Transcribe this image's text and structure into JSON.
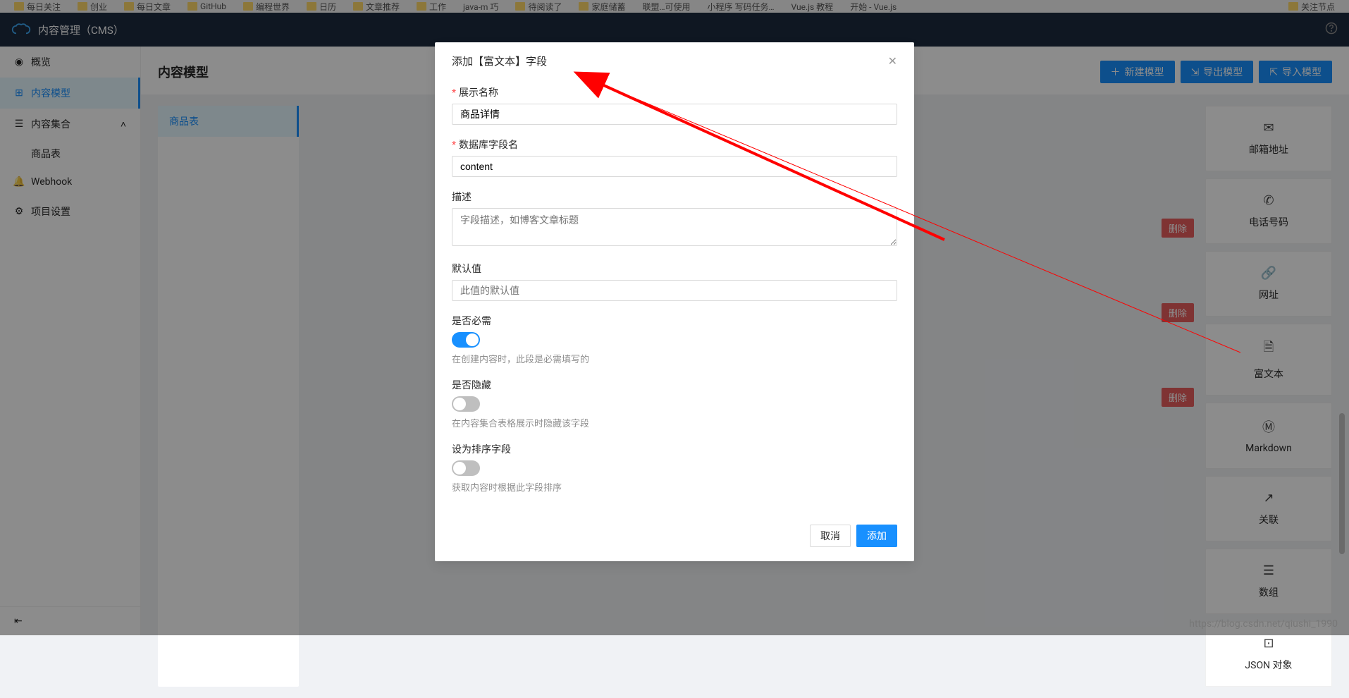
{
  "browserBar": {
    "bookmarks": [
      "每日关注",
      "创业",
      "每日文章",
      "GitHub",
      "编程世界",
      "日历",
      "文章推荐",
      "工作",
      "java-m 巧",
      "待阅读了",
      "家庭储蓄",
      "联盟…可使用",
      "小程序 写码任务…",
      "Vue.js 教程",
      "开始 - Vue.js"
    ],
    "bookmarkRight": "关注节点"
  },
  "appHeader": {
    "title": "内容管理（CMS）"
  },
  "sidebar": {
    "items": [
      "概览",
      "内容模型",
      "内容集合",
      "Webhook",
      "项目设置"
    ],
    "subItems": [
      "商品表"
    ]
  },
  "page": {
    "title": "内容模型",
    "actions": {
      "create": "新建模型",
      "export": "导出模型",
      "import": "导入模型"
    }
  },
  "leftPanel": {
    "item": "商品表"
  },
  "deleteLabel": "删除",
  "fieldTypes": {
    "email": "邮箱地址",
    "phone": "电话号码",
    "url": "网址",
    "richtext": "富文本",
    "markdown": "Markdown",
    "relation": "关联",
    "array": "数组",
    "json": "JSON 对象"
  },
  "modal": {
    "title": "添加【富文本】字段",
    "labels": {
      "displayName": "展示名称",
      "dbField": "数据库字段名",
      "description": "描述",
      "defaultValue": "默认值",
      "required": "是否必需",
      "hidden": "是否隐藏",
      "sortField": "设为排序字段"
    },
    "values": {
      "displayName": "商品详情",
      "dbField": "content"
    },
    "placeholders": {
      "description": "字段描述，如博客文章标题",
      "defaultValue": "此值的默认值"
    },
    "hints": {
      "required": "在创建内容时，此段是必需填写的",
      "hidden": "在内容集合表格展示时隐藏该字段",
      "sortField": "获取内容时根据此字段排序"
    },
    "buttons": {
      "cancel": "取消",
      "add": "添加"
    }
  },
  "watermark": "https://blog.csdn.net/qiushi_1990"
}
